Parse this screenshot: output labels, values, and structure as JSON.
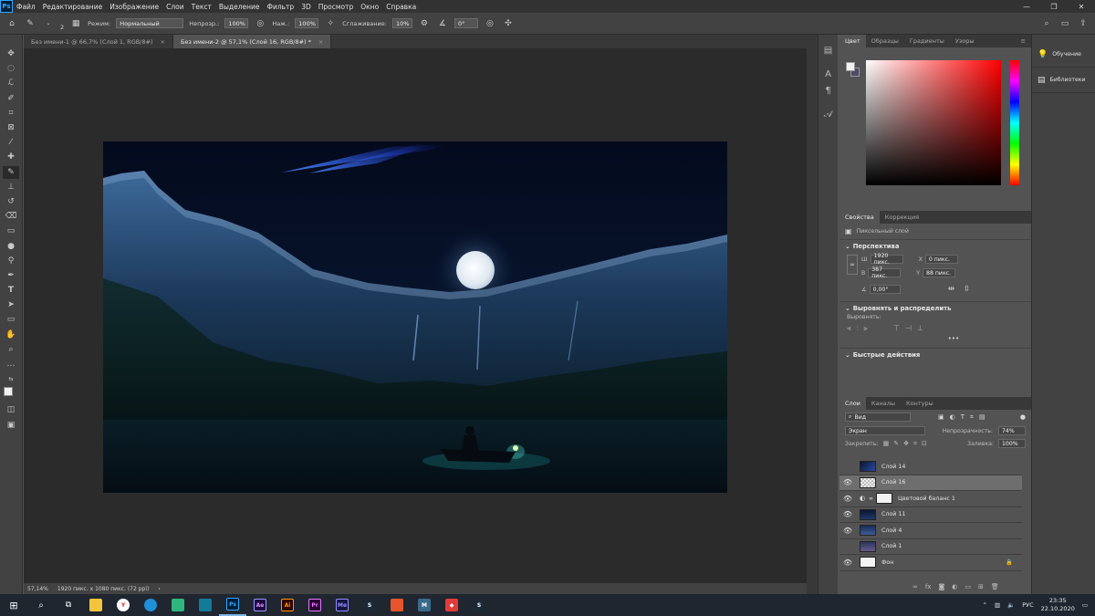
{
  "app": {
    "logo": "Ps"
  },
  "menu": [
    "Файл",
    "Редактирование",
    "Изображение",
    "Слои",
    "Текст",
    "Выделение",
    "Фильтр",
    "3D",
    "Просмотр",
    "Окно",
    "Справка"
  ],
  "options": {
    "brush_size": "2",
    "mode_label": "Режим:",
    "mode_value": "Нормальный",
    "opacity_label": "Непрозр.:",
    "opacity_value": "100%",
    "flow_label": "Наж.:",
    "flow_value": "100%",
    "smoothing_label": "Сглаживание:",
    "smoothing_value": "10%",
    "angle_value": "0°"
  },
  "tabs": [
    {
      "label": "Без имени-1 @ 66,7% (Слой 1, RGB/8#)",
      "close": "×"
    },
    {
      "label": "Без имени-2 @ 57,1% (Слой 16, RGB/8#) *",
      "close": "×"
    }
  ],
  "status": {
    "zoom": "57,14%",
    "doc_info": "1920 пикс. x 1080 пикс. (72 ppi)",
    "arrow": "›"
  },
  "color_panel": {
    "tabs": [
      "Цвет",
      "Образцы",
      "Градиенты",
      "Узоры"
    ],
    "menu": "≡"
  },
  "properties": {
    "tabs": [
      "Свойства",
      "Коррекция"
    ],
    "layer_kind": "Пиксельный слой",
    "transform_title": "Перспектива",
    "w_label": "Ш",
    "w_value": "1920 пикс.",
    "h_label": "В",
    "h_value": "387 пикс.",
    "x_label": "X",
    "x_value": "0 пикс.",
    "y_label": "Y",
    "y_value": "88 пикс.",
    "angle_value": "0,00°",
    "align_title": "Выровнять и распределить",
    "align_label": "Выровнять:",
    "more": "•••",
    "quick_title": "Быстрые действия"
  },
  "layers": {
    "tabs": [
      "Слои",
      "Каналы",
      "Контуры"
    ],
    "filter_value": "Вид",
    "blend_mode": "Экран",
    "opacity_label": "Непрозрачность:",
    "opacity_value": "74%",
    "lock_label": "Закрепить:",
    "fill_label": "Заливка:",
    "fill_value": "100%",
    "rows": [
      {
        "name": "Слой 14",
        "visible": false
      },
      {
        "name": "Слой 16",
        "visible": true
      },
      {
        "name": "Цветовой баланс 1",
        "visible": true
      },
      {
        "name": "Слой 11",
        "visible": true
      },
      {
        "name": "Слой 4",
        "visible": true
      },
      {
        "name": "Слой 1",
        "visible": false
      },
      {
        "name": "Фон",
        "visible": true
      }
    ]
  },
  "right_panel": {
    "learn": "Обучение",
    "libraries": "Библиотеки"
  },
  "taskbar": {
    "lang": "РУС",
    "time": "23:35",
    "date": "22.10.2020"
  },
  "colors": {
    "accent": "#31a8ff",
    "chrome": "#535353",
    "canvas_bg": "#2b2b2b"
  }
}
